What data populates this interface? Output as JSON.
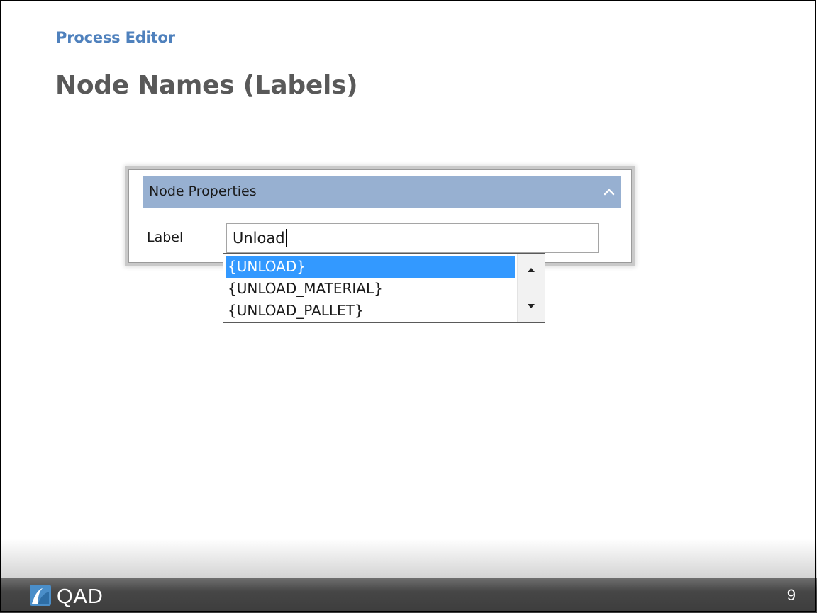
{
  "slide": {
    "subtitle": "Process Editor",
    "title": "Node Names (Labels)",
    "page_number": "9"
  },
  "panel": {
    "header": "Node Properties",
    "header_color": "#97b0d1",
    "label_field": {
      "label": "Label",
      "value": "Unload"
    },
    "collapse_icon": "chevron-up-icon"
  },
  "autocomplete": {
    "selected_index": 0,
    "selected_color": "#3399ff",
    "items": [
      "{UNLOAD}",
      "{UNLOAD_MATERIAL}",
      "{UNLOAD_PALLET}"
    ]
  },
  "footer": {
    "logo_text": "QAD",
    "logo_icon": "qad-logo-icon"
  }
}
